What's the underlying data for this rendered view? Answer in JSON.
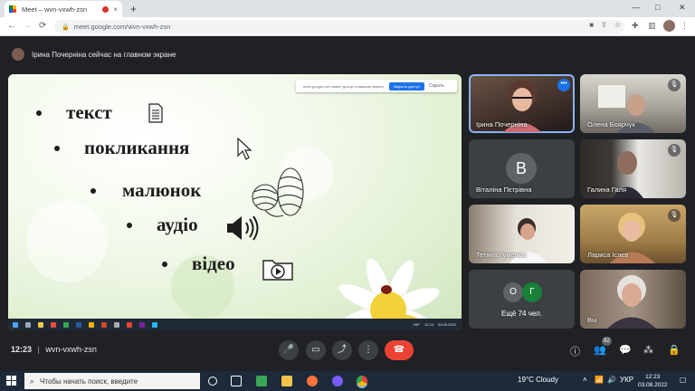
{
  "browser": {
    "tab_title": "Meet – wvn-vxwh-zsn",
    "tab_close": "×",
    "new_tab": "+",
    "minimize": "—",
    "maximize": "□",
    "close": "✕",
    "url": "meet.google.com/wvn-vxwh-zsn"
  },
  "banner": {
    "text": "Ірина Почерніна сейчас на главном экране"
  },
  "presentation": {
    "bullets": [
      "текст",
      "покликання",
      "малюнок",
      "аудіо",
      "відео"
    ],
    "notice_text": "meet.google.com имеет доступ к вашему экрану",
    "notice_button": "Закрыть доступ",
    "notice_close": "Скрыть",
    "mini_clock": "12:23",
    "mini_date": "03.08.2022",
    "mini_lang": "УКР"
  },
  "participants": [
    {
      "name": "Ірина Почерніна",
      "speaking": true
    },
    {
      "name": "Олена Боярчук",
      "muted": true
    },
    {
      "name": "Віталіна Пєтрівна",
      "initial": "В",
      "muted": false
    },
    {
      "name": "Галина Галя",
      "muted": true
    },
    {
      "name": "Тетяна Гуменюк",
      "muted": false
    },
    {
      "name": "Лариса Ісаєв",
      "muted": true
    },
    {
      "name": "Вы",
      "muted": false
    }
  ],
  "more": {
    "initials": [
      "О",
      "Г"
    ],
    "label": "Ещё 74 чел."
  },
  "bottom": {
    "time": "12:23",
    "separator": "|",
    "code": "wvn-vxwh-zsn",
    "people_count": "82"
  },
  "taskbar": {
    "search_placeholder": "Чтобы начать поиск, введите",
    "weather": "19°C  Cloudy",
    "lang": "УКР",
    "time": "12:23",
    "date": "03.08.2022"
  },
  "colors": {
    "meet_bg": "#202124",
    "end_call": "#ea4335",
    "accent": "#1a73e8",
    "speaking_border": "#8ab4f8"
  }
}
